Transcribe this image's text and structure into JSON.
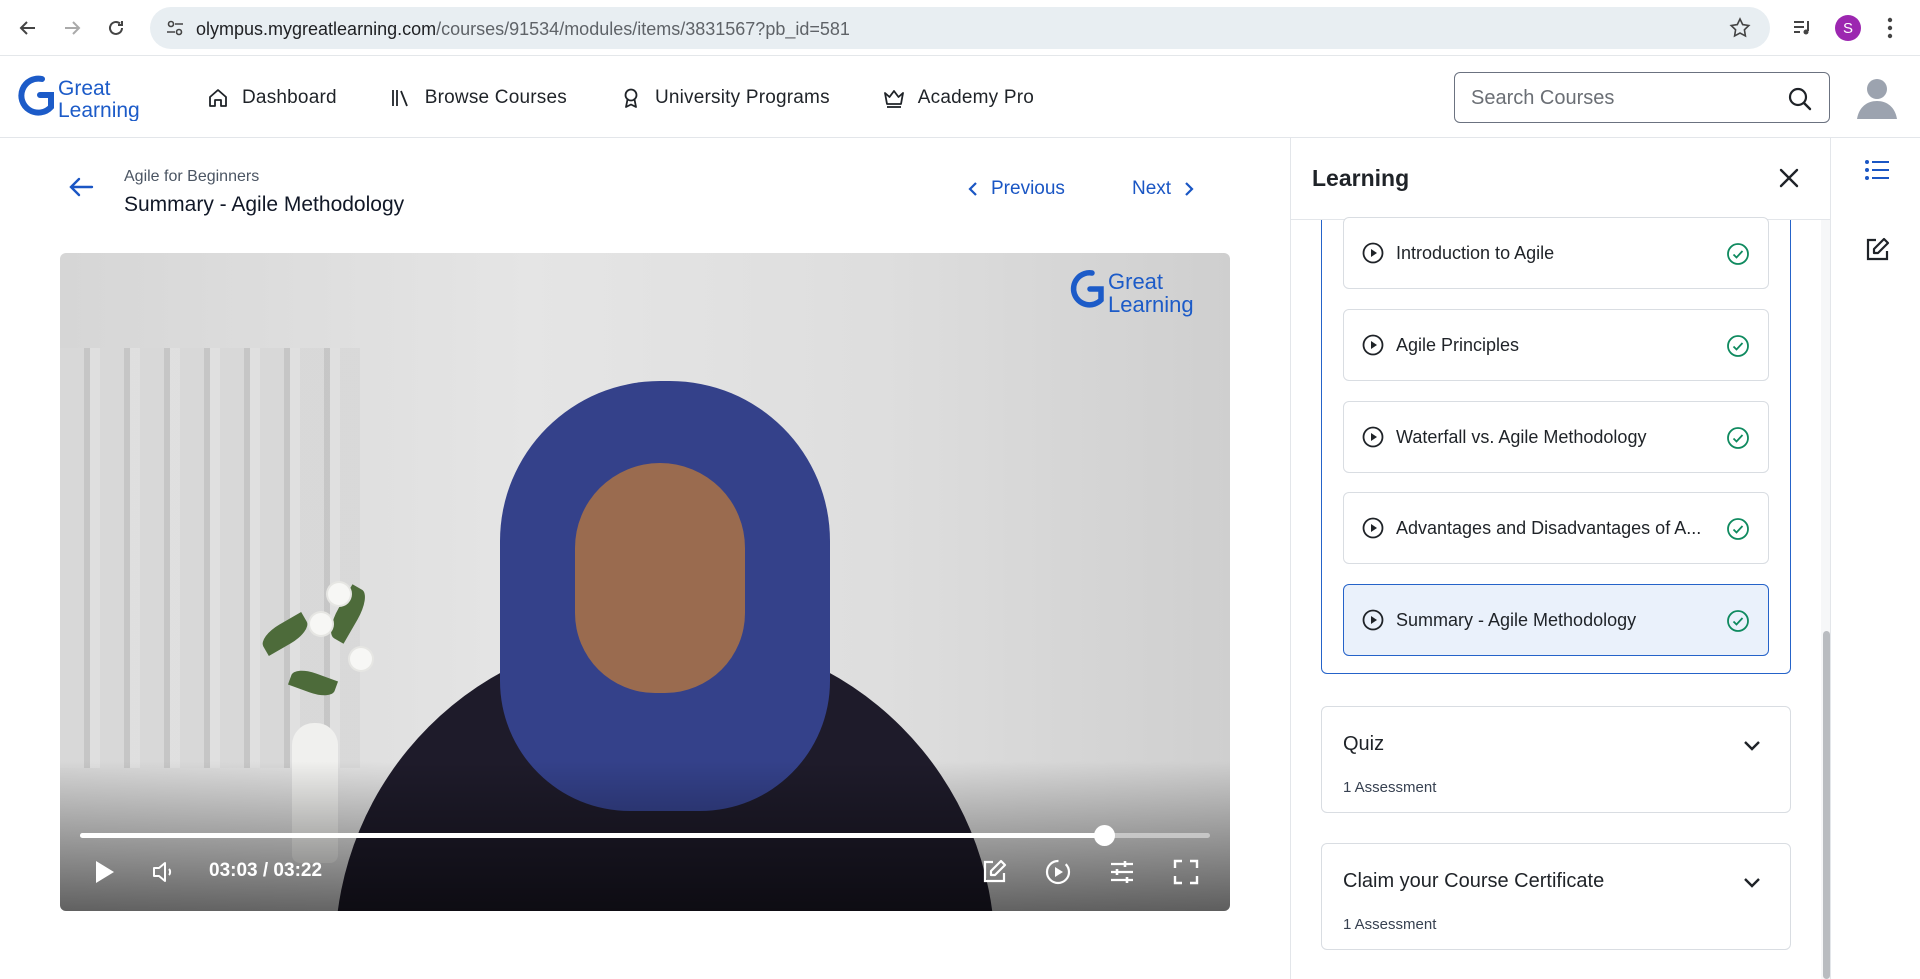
{
  "browser": {
    "url_host": "olympus.mygreatlearning.com",
    "url_path": "/courses/91534/modules/items/3831567?pb_id=581",
    "profile_initial": "S"
  },
  "header": {
    "logo_line1": "Great",
    "logo_line2": "Learning",
    "nav": [
      {
        "label": "Dashboard",
        "icon": "home-icon"
      },
      {
        "label": "Browse Courses",
        "icon": "library-icon"
      },
      {
        "label": "University Programs",
        "icon": "award-icon"
      },
      {
        "label": "Academy Pro",
        "icon": "crown-icon"
      }
    ],
    "search_placeholder": "Search Courses"
  },
  "lesson_header": {
    "course": "Agile for Beginners",
    "title": "Summary - Agile Methodology",
    "previous_label": "Previous",
    "next_label": "Next"
  },
  "video": {
    "watermark_line1": "Great",
    "watermark_line2": "Learning",
    "time": "03:03 / 03:22",
    "progress": 0.906
  },
  "panel": {
    "title": "Learning",
    "lessons": [
      {
        "title": "Introduction to Agile",
        "completed": true,
        "active": false
      },
      {
        "title": "Agile Principles",
        "completed": true,
        "active": false
      },
      {
        "title": "Waterfall vs. Agile Methodology",
        "completed": true,
        "active": false
      },
      {
        "title": "Advantages and Disadvantages of A...",
        "completed": true,
        "active": false
      },
      {
        "title": "Summary - Agile Methodology",
        "completed": true,
        "active": true
      }
    ],
    "sections": [
      {
        "title": "Quiz",
        "subtitle": "1 Assessment"
      },
      {
        "title": "Claim your Course Certificate",
        "subtitle": "1 Assessment"
      }
    ]
  },
  "colors": {
    "accent": "#1a56c4",
    "check": "#0f8a5f",
    "brand_blue": "#1c5bc8"
  }
}
